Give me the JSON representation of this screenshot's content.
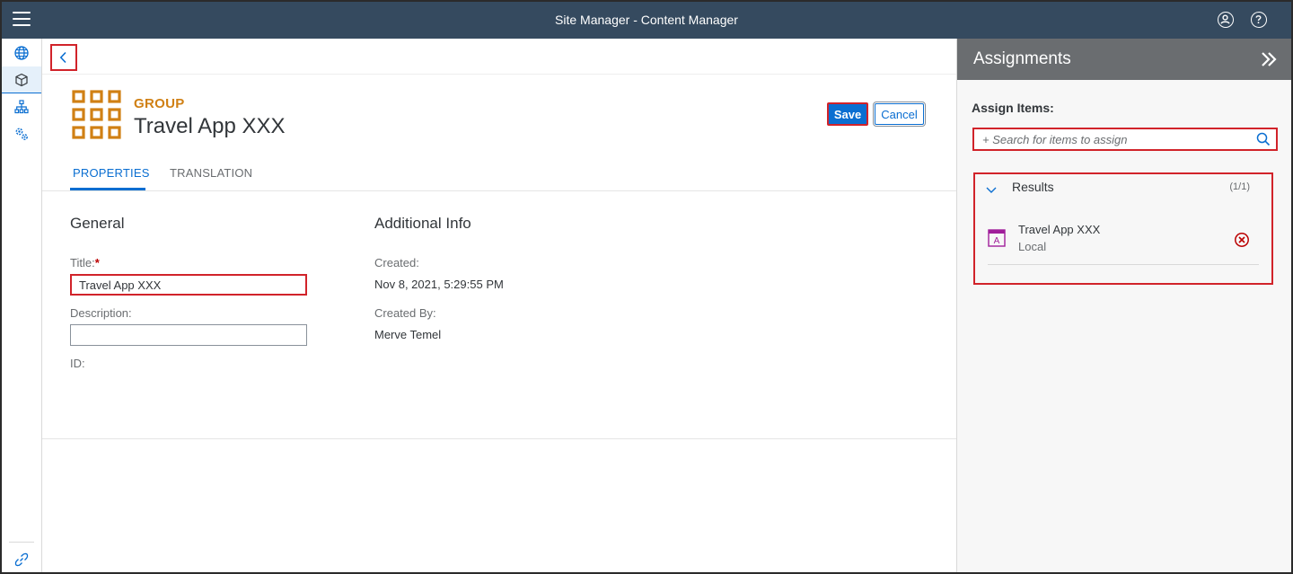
{
  "shell": {
    "title": "Site Manager - Content Manager",
    "menu_icon": "hamburger-menu-icon",
    "user_icon": "user-profile-icon",
    "help_icon": "help-icon"
  },
  "nav": {
    "items": [
      {
        "name": "sites",
        "icon": "globe-icon"
      },
      {
        "name": "content",
        "icon": "cube-icon",
        "active": true
      },
      {
        "name": "hierarchy",
        "icon": "org-chart-icon"
      },
      {
        "name": "settings",
        "icon": "gears-icon"
      }
    ],
    "bottom_icon": "link-icon"
  },
  "header": {
    "type_label": "GROUP",
    "title": "Travel App XXX",
    "save_label": "Save",
    "cancel_label": "Cancel"
  },
  "tabs": [
    {
      "label": "PROPERTIES",
      "active": true
    },
    {
      "label": "TRANSLATION",
      "active": false
    }
  ],
  "general": {
    "heading": "General",
    "title_label": "Title:",
    "required_mark": "*",
    "title_value": "Travel App XXX",
    "description_label": "Description:",
    "description_value": "",
    "id_label": "ID:"
  },
  "additional": {
    "heading": "Additional Info",
    "created_label": "Created:",
    "created_value": "Nov 8, 2021, 5:29:55 PM",
    "created_by_label": "Created By:",
    "created_by_value": "Merve Temel"
  },
  "assignments": {
    "title": "Assignments",
    "assign_label": "Assign Items:",
    "search_placeholder": "+ Search for items to assign",
    "results_title": "Results",
    "results_count": "(1/1)",
    "items": [
      {
        "name": "Travel App XXX",
        "sub": "Local",
        "icon": "app-tile-icon"
      }
    ]
  },
  "colors": {
    "shell": "#354a5f",
    "accent": "#0a6ed1",
    "group_orange": "#d08014",
    "highlight_red": "#d1232a",
    "panel_header": "#6a6d70",
    "app_purple": "#a01e9a"
  }
}
